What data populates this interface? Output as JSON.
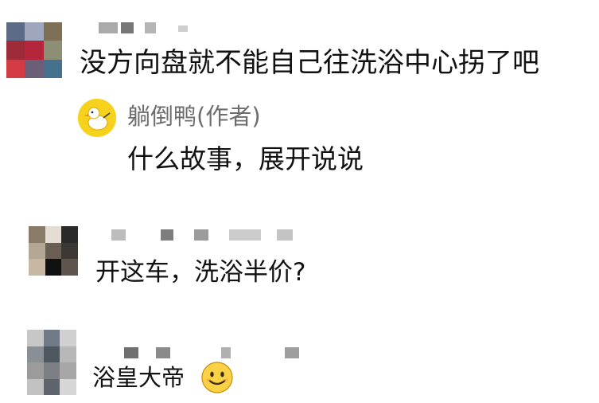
{
  "comments": [
    {
      "avatar_desc": "pixelated avatar",
      "text": "没方向盘就不能自己往洗浴中心拐了吧",
      "reply": {
        "author": "躺倒鸭(作者)",
        "avatar_icon": "duck-avatar-icon",
        "text": "什么故事，展开说说"
      }
    },
    {
      "avatar_desc": "pixelated avatar",
      "text": "开这车，洗浴半价?"
    },
    {
      "avatar_desc": "pixelated avatar",
      "text": "浴皇大帝",
      "emoji": "smile-emoji-icon"
    }
  ],
  "colors": {
    "text": "#111111",
    "author": "#6d6d6d",
    "duck_avatar_bg": "#f7d21c",
    "emoji_face": "#fbd145"
  }
}
